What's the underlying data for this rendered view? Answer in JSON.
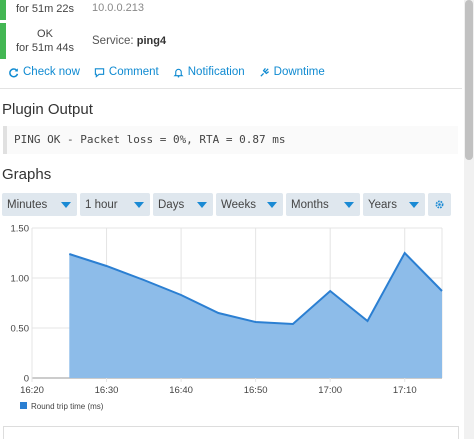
{
  "rows": [
    {
      "state": "OK",
      "duration": "for 51m 22s",
      "host": "",
      "ip": "10.0.0.213"
    },
    {
      "state": "OK",
      "duration": "for 51m 44s",
      "service_label": "Service:",
      "service": "ping4"
    }
  ],
  "actions": {
    "check_now": "Check now",
    "comment": "Comment",
    "notification": "Notification",
    "downtime": "Downtime"
  },
  "plugin_output": {
    "title": "Plugin Output",
    "text": "PING OK - Packet loss = 0%, RTA = 0.87 ms"
  },
  "graphs": {
    "title": "Graphs",
    "controls": [
      "Minutes",
      "1 hour",
      "Days",
      "Weeks",
      "Months",
      "Years"
    ],
    "settings_icon": "gear-icon"
  },
  "chart_data": {
    "type": "area",
    "x_ticks": [
      "16:20",
      "16:30",
      "16:40",
      "16:50",
      "17:00",
      "17:10"
    ],
    "y_ticks": [
      "0",
      "0.50",
      "1.00",
      "1.50"
    ],
    "ylim": [
      0,
      1.5
    ],
    "x_minutes": [
      5,
      10,
      15,
      20,
      25,
      30,
      35,
      40,
      45,
      50,
      55
    ],
    "x_range_minutes": [
      0,
      55
    ],
    "series": [
      {
        "name": "Round trip time (ms)",
        "x": [
          5,
          10,
          15,
          20,
          25,
          30,
          35,
          40,
          45,
          50,
          55
        ],
        "values": [
          1.24,
          1.12,
          0.98,
          0.83,
          0.65,
          0.56,
          0.54,
          0.87,
          0.57,
          1.25,
          0.87
        ]
      }
    ],
    "colors": {
      "fill": "#8dbce9",
      "line": "#2b7fd2",
      "grid": "#e4e4e4"
    },
    "grid": true,
    "legend_position": "bottom-left"
  }
}
